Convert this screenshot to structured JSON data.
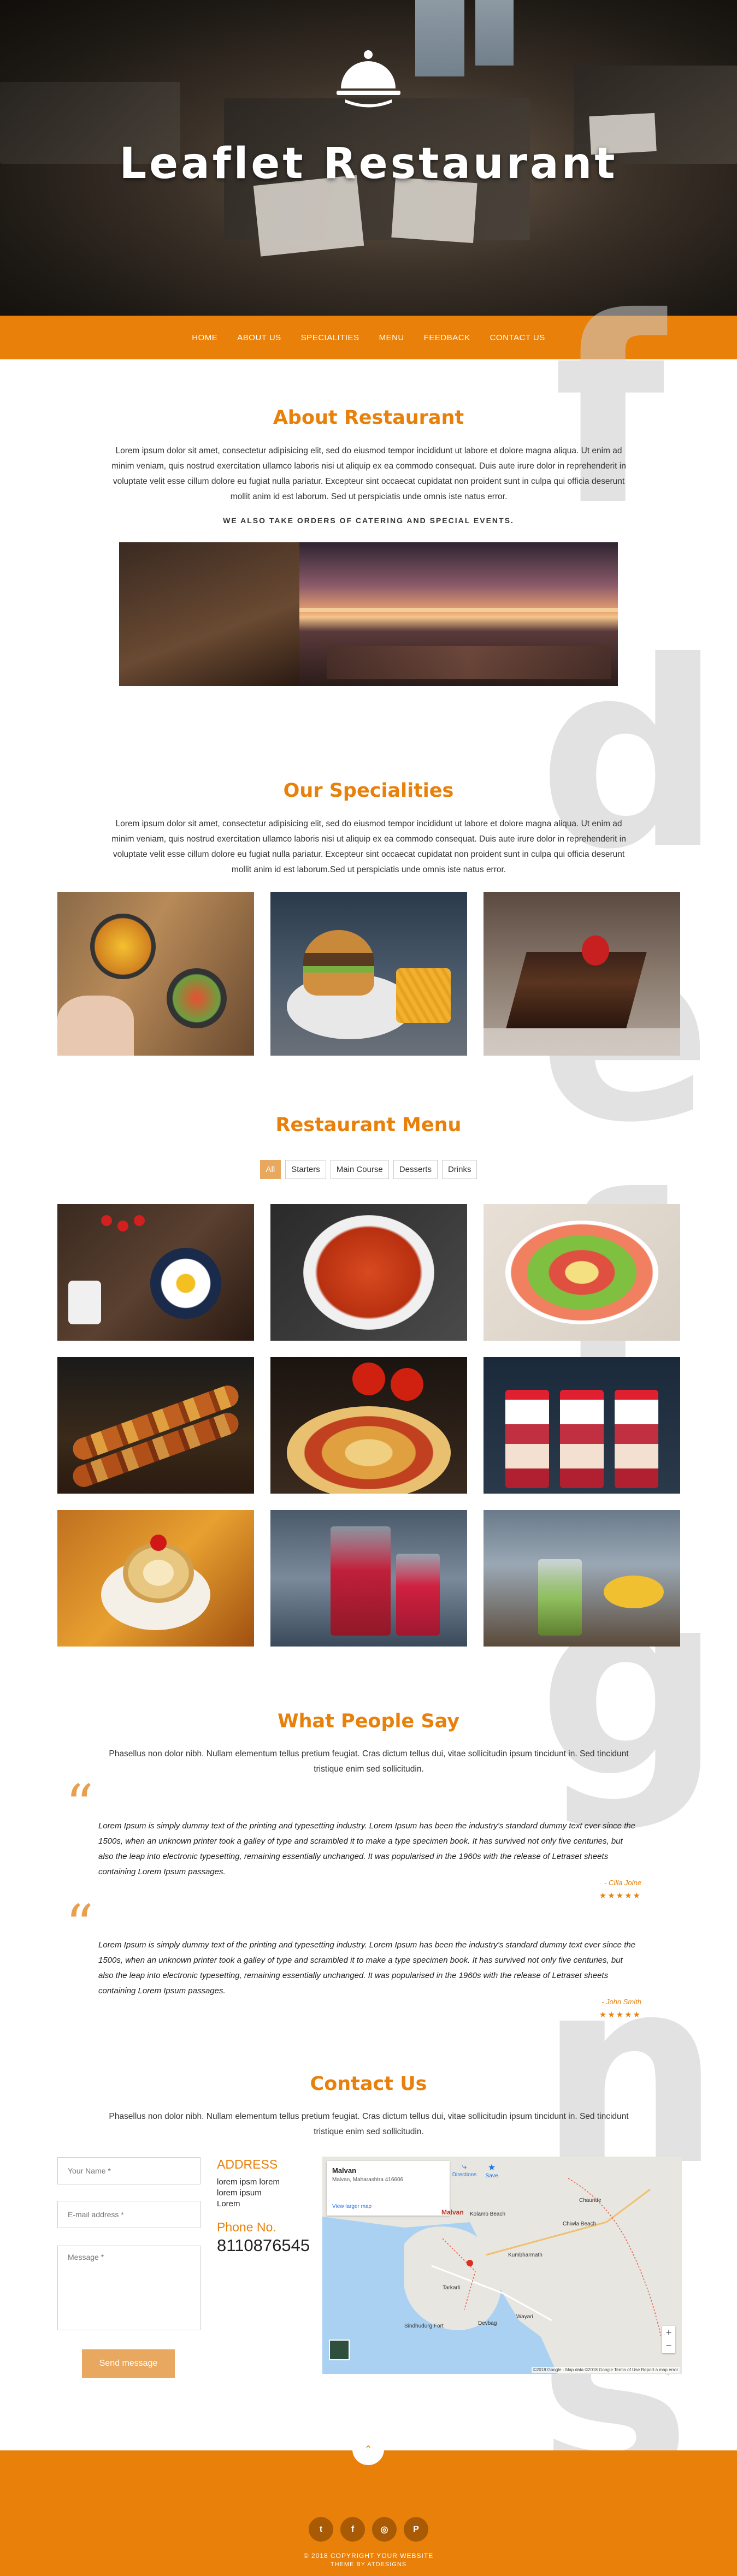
{
  "hero": {
    "title": "Leaflet Restaurant"
  },
  "nav": [
    "HOME",
    "ABOUT US",
    "SPECIALITIES",
    "MENU",
    "FEEDBACK",
    "CONTACT US"
  ],
  "side_letters": [
    "f",
    "d",
    "e",
    "f",
    "g",
    "n",
    "s"
  ],
  "about": {
    "title": "About Restaurant",
    "text": "Lorem ipsum dolor sit amet, consectetur adipisicing elit, sed do eiusmod tempor incididunt ut labore et dolore magna aliqua. Ut enim ad minim veniam, quis nostrud exercitation ullamco laboris nisi ut aliquip ex ea commodo consequat. Duis aute irure dolor in reprehenderit in voluptate velit esse cillum dolore eu fugiat nulla pariatur. Excepteur sint occaecat cupidatat non proident sunt in culpa qui officia deserunt mollit anim id est laborum. Sed ut perspiciatis unde omnis iste natus error.",
    "catering": "WE ALSO TAKE ORDERS OF CATERING AND SPECIAL EVENTS."
  },
  "specialities": {
    "title": "Our Specialities",
    "text": "Lorem ipsum dolor sit amet, consectetur adipisicing elit, sed do eiusmod tempor incididunt ut labore et dolore magna aliqua. Ut enim ad minim veniam, quis nostrud exercitation ullamco laboris nisi ut aliquip ex ea commodo consequat. Duis aute irure dolor in reprehenderit in voluptate velit esse cillum dolore eu fugiat nulla pariatur. Excepteur sint occaecat cupidatat non proident sunt in culpa qui officia deserunt mollit anim id est laborum.Sed ut perspiciatis unde omnis iste natus error."
  },
  "menu": {
    "title": "Restaurant Menu",
    "filters": [
      "All",
      "Starters",
      "Main Course",
      "Desserts",
      "Drinks"
    ],
    "active_filter": "All"
  },
  "testimonials": {
    "title": "What People Say",
    "intro": "Phasellus non dolor nibh. Nullam elementum tellus pretium feugiat. Cras dictum tellus dui, vitae sollicitudin ipsum tincidunt in. Sed tincidunt tristique enim sed sollicitudin.",
    "items": [
      {
        "text": "Lorem Ipsum is simply dummy text of the printing and typesetting industry. Lorem Ipsum has been the industry's standard dummy text ever since the 1500s, when an unknown printer took a galley of type and scrambled it to make a type specimen book. It has survived not only five centuries, but also the leap into electronic typesetting, remaining essentially unchanged. It was popularised in the 1960s with the release of Letraset sheets containing Lorem Ipsum passages.",
        "author": "- Cilla Jolne",
        "stars": "★★★★★"
      },
      {
        "text": "Lorem Ipsum is simply dummy text of the printing and typesetting industry. Lorem Ipsum has been the industry's standard dummy text ever since the 1500s, when an unknown printer took a galley of type and scrambled it to make a type specimen book. It has survived not only five centuries, but also the leap into electronic typesetting, remaining essentially unchanged. It was popularised in the 1960s with the release of Letraset sheets containing Lorem Ipsum passages.",
        "author": "- John Smith",
        "stars": "★★★★★"
      }
    ]
  },
  "contact": {
    "title": "Contact Us",
    "intro": "Phasellus non dolor nibh. Nullam elementum tellus pretium feugiat. Cras dictum tellus dui, vitae sollicitudin ipsum tincidunt in. Sed tincidunt tristique enim sed sollicitudin.",
    "name_placeholder": "Your Name *",
    "email_placeholder": "E-mail address *",
    "message_placeholder": "Message *",
    "send_label": "Send message",
    "address_heading": "ADDRESS",
    "address_lines": [
      "lorem ipsm lorem",
      "lorem ipsum",
      "Lorem"
    ],
    "phone_heading": "Phone No.",
    "phone": "8110876545"
  },
  "map": {
    "place": "Malvan",
    "place_sub": "Malvan, Maharashtra 416606",
    "directions": "Directions",
    "save": "Save",
    "larger": "View larger map",
    "labels": [
      "Malvan",
      "Tarkarli",
      "Devbag",
      "Chaunde",
      "Kumbharmath",
      "Sindhudurg Fort",
      "Wayari",
      "Kolamb Beach",
      "Chiwla Beach"
    ],
    "attribution": "©2018 Google - Map data ©2018 Google   Terms of Use   Report a map error"
  },
  "footer": {
    "up_icon": "chevron-up-icon",
    "social": [
      "twitter-icon",
      "facebook-icon",
      "instagram-icon",
      "pinterest-icon"
    ],
    "copyright": "© 2018 COPYRIGHT YOUR WEBSITE",
    "theme": "THEME BY ATDESIGNS"
  },
  "colors": {
    "accent": "#e8800a",
    "accent_light": "#e8a860"
  }
}
